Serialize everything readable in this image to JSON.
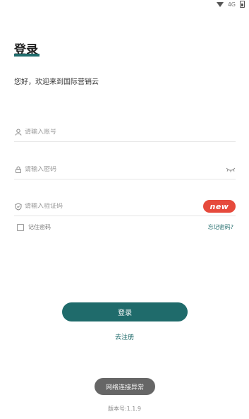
{
  "status_bar": {
    "wifi_icon": "wifi-icon",
    "signal_text": "4G",
    "battery_icon": "battery-icon"
  },
  "page": {
    "title": "登录",
    "welcome": "您好，欢迎来到国际营销云",
    "accent_color": "#1f6b6b"
  },
  "form": {
    "account": {
      "placeholder": "请输入账号",
      "icon": "user-icon"
    },
    "password": {
      "placeholder": "请输入密码",
      "icon": "lock-icon",
      "toggle_icon": "eye-closed-icon"
    },
    "captcha": {
      "placeholder": "请输入验证码",
      "icon": "shield-icon",
      "captcha_text": "new"
    },
    "remember_label": "记住密码",
    "forgot_label": "忘记密码?"
  },
  "actions": {
    "login_label": "登录",
    "register_label": "去注册"
  },
  "toast": {
    "text": "网络连接异常"
  },
  "footer": {
    "version": "版本号:1.1.9"
  }
}
